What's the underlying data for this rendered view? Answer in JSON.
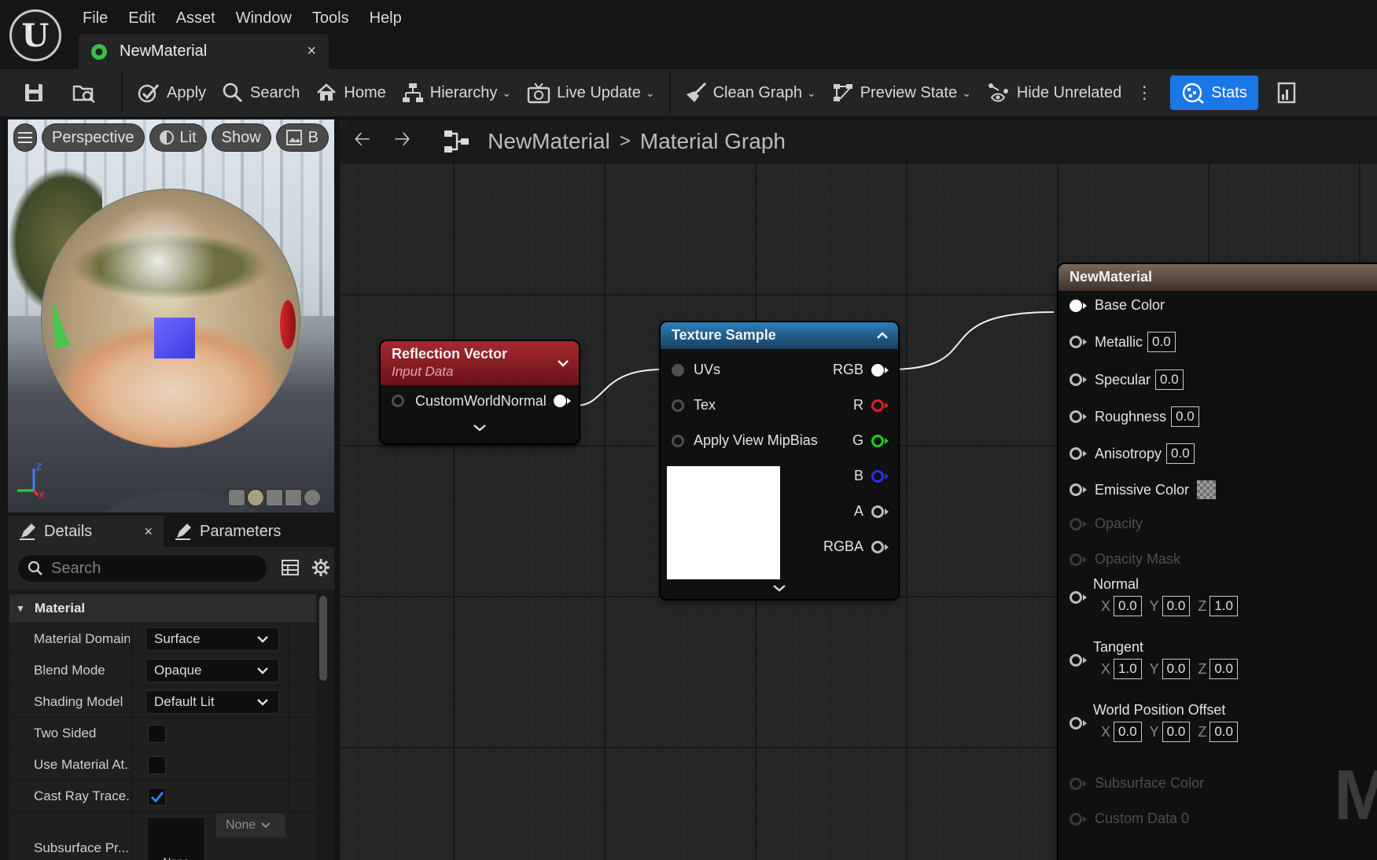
{
  "menu": [
    "File",
    "Edit",
    "Asset",
    "Window",
    "Tools",
    "Help"
  ],
  "document_tab": {
    "label": "NewMaterial",
    "close": "×"
  },
  "toolbar": {
    "apply": "Apply",
    "search": "Search",
    "home": "Home",
    "hierarchy": "Hierarchy",
    "live_update": "Live Update",
    "clean_graph": "Clean Graph",
    "preview_state": "Preview State",
    "hide_unrelated": "Hide Unrelated",
    "stats": "Stats",
    "more": "⋮"
  },
  "viewport": {
    "perspective": "Perspective",
    "lit": "Lit",
    "show": "Show",
    "extra": "B",
    "axis_z": "Z",
    "axis_x": "X"
  },
  "details": {
    "tab_details": "Details",
    "tab_close": "×",
    "tab_parameters": "Parameters",
    "search_placeholder": "Search",
    "category": "Material",
    "props": {
      "material_domain": {
        "name": "Material Domain",
        "value": "Surface"
      },
      "blend_mode": {
        "name": "Blend Mode",
        "value": "Opaque"
      },
      "shading_model": {
        "name": "Shading Model",
        "value": "Default Lit"
      },
      "two_sided": {
        "name": "Two Sided"
      },
      "use_material_at": {
        "name": "Use Material At..."
      },
      "cast_ray_trace": {
        "name": "Cast Ray Trace..."
      },
      "subsurface": {
        "name": "Subsurface Pr...",
        "thumb": "None",
        "combo": "None"
      }
    }
  },
  "graph": {
    "breadcrumb_root": "NewMaterial",
    "breadcrumb_sep": ">",
    "breadcrumb_current": "Material Graph",
    "watermark": "M"
  },
  "reflection_node": {
    "title": "Reflection Vector",
    "subtitle": "Input Data",
    "pin": "CustomWorldNormal",
    "color": "#8f1d22"
  },
  "texture_node": {
    "title": "Texture Sample",
    "color": "#1f5a86",
    "inputs": [
      "UVs",
      "Tex",
      "Apply View MipBias"
    ],
    "outputs": [
      "RGB",
      "R",
      "G",
      "B",
      "A",
      "RGBA"
    ]
  },
  "material_node": {
    "title": "NewMaterial",
    "color": "#5b4d43",
    "base_color": "Base Color",
    "metallic": {
      "label": "Metallic",
      "value": "0.0"
    },
    "specular": {
      "label": "Specular",
      "value": "0.0"
    },
    "roughness": {
      "label": "Roughness",
      "value": "0.0"
    },
    "anisotropy": {
      "label": "Anisotropy",
      "value": "0.0"
    },
    "emissive": "Emissive Color",
    "opacity": "Opacity",
    "opacity_mask": "Opacity Mask",
    "normal": {
      "label": "Normal",
      "x": "0.0",
      "y": "0.0",
      "z": "1.0"
    },
    "tangent": {
      "label": "Tangent",
      "x": "1.0",
      "y": "0.0",
      "z": "0.0"
    },
    "wpo": {
      "label": "World Position Offset",
      "x": "0.0",
      "y": "0.0",
      "z": "0.0"
    },
    "subsurface": "Subsurface Color",
    "custom_data": "Custom Data 0",
    "axis_x": "X",
    "axis_y": "Y",
    "axis_z": "Z"
  }
}
